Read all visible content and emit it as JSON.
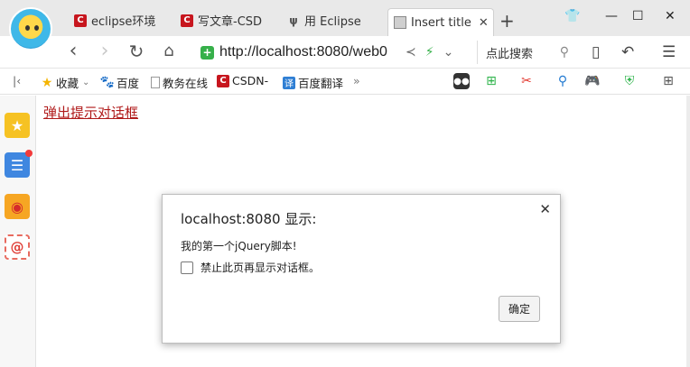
{
  "tabs": [
    {
      "label": "eclipse环境",
      "icon": "csdn-c-icon"
    },
    {
      "label": "写文章-CSD",
      "icon": "csdn-c-icon"
    },
    {
      "label": "用 Eclipse",
      "icon": "eclipse-icon"
    },
    {
      "label": "Insert title",
      "icon": "page-image-icon",
      "active": true
    }
  ],
  "address": {
    "url": "http://localhost:8080/web0",
    "search_label": "点此搜索"
  },
  "bookmarks": [
    {
      "label": "收藏",
      "icon": "star-icon"
    },
    {
      "label": "百度",
      "icon": "paw-icon"
    },
    {
      "label": "教务在线",
      "icon": "doc-icon"
    },
    {
      "label": "CSDN-",
      "icon": "csdn-c-icon"
    },
    {
      "label": "百度翻译",
      "icon": "translate-icon"
    }
  ],
  "page": {
    "link_text": "弹出提示对话框"
  },
  "dialog": {
    "title": "localhost:8080 显示:",
    "message": "我的第一个jQuery脚本!",
    "checkbox_label": "禁止此页再显示对话框。",
    "ok_label": "确定"
  },
  "colors": {
    "link": "#b01a1a",
    "secure": "#36b04a",
    "csdn_red": "#c7161e"
  }
}
